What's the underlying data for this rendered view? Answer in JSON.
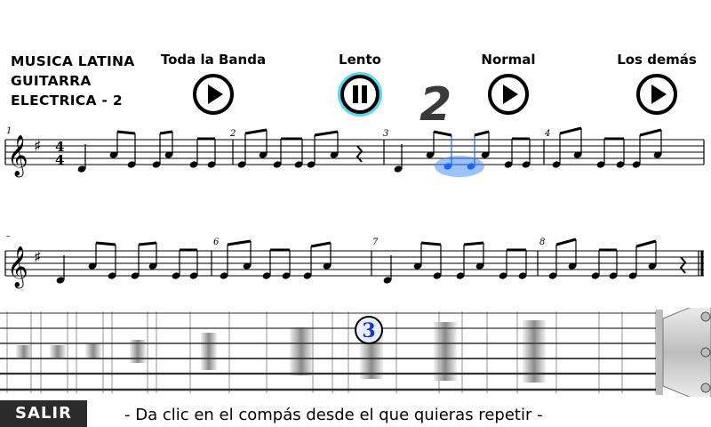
{
  "title_lines": [
    "MUSICA LATINA",
    "GUITARRA",
    "ELECTRICA - 2"
  ],
  "controls": [
    {
      "label": "Toda la Banda",
      "icon": "play-icon"
    },
    {
      "label": "Lento",
      "icon": "pause-icon",
      "active": true
    },
    {
      "label": "Normal",
      "icon": "play-icon"
    },
    {
      "label": "Los demás",
      "icon": "play-icon"
    }
  ],
  "count_in": "2",
  "measure_numbers": [
    "1",
    "2",
    "3",
    "4",
    "5",
    "6",
    "7",
    "8"
  ],
  "time_signature": {
    "top": "4",
    "bottom": "4"
  },
  "fret_marker_label": "3",
  "exit_label": "SALIR",
  "hint_text": "- Da clic en el compás desde el que quieras repetir -",
  "colors": {
    "highlight": "#1e63ff",
    "pause_glow": "#39d2f0"
  }
}
